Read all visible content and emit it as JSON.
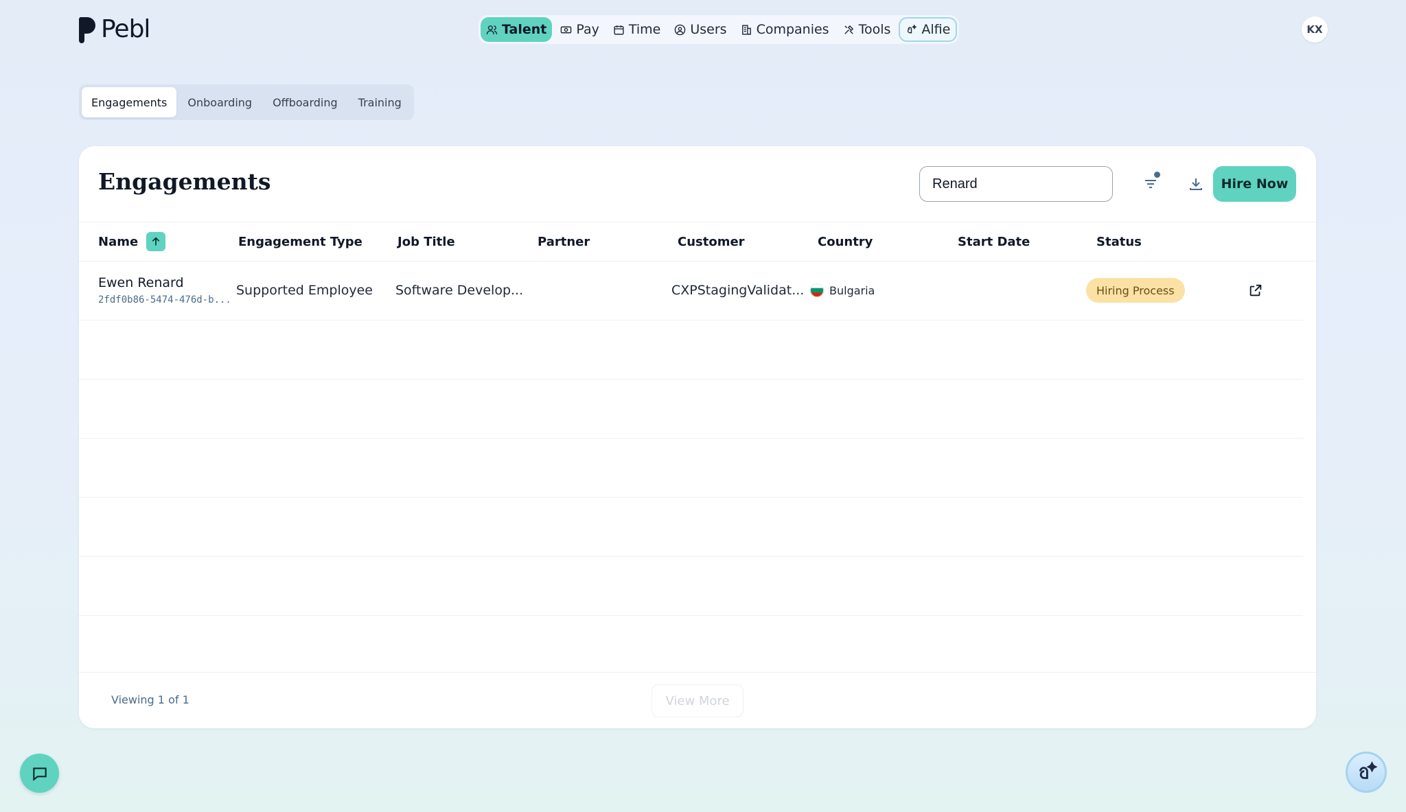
{
  "brand": {
    "name": "Pebl"
  },
  "topnav": {
    "items": [
      {
        "label": "Talent",
        "icon": "users-icon"
      },
      {
        "label": "Pay",
        "icon": "money-icon"
      },
      {
        "label": "Time",
        "icon": "calendar-icon"
      },
      {
        "label": "Users",
        "icon": "user-circle-icon"
      },
      {
        "label": "Companies",
        "icon": "building-icon"
      },
      {
        "label": "Tools",
        "icon": "tools-icon"
      },
      {
        "label": "Alfie",
        "icon": "alfie-icon"
      }
    ],
    "active": "Talent"
  },
  "user": {
    "initials": "KX"
  },
  "subtabs": {
    "items": [
      "Engagements",
      "Onboarding",
      "Offboarding",
      "Training"
    ],
    "active": "Engagements"
  },
  "main": {
    "title": "Engagements",
    "search": {
      "value": "Renard",
      "placeholder": "Search"
    },
    "hire_button": "Hire Now",
    "filter_active": true
  },
  "table": {
    "columns": [
      "Name",
      "Engagement Type",
      "Job Title",
      "Partner",
      "Customer",
      "Country",
      "Start Date",
      "Status"
    ],
    "sort": {
      "column": "Name",
      "direction": "ascending"
    },
    "rows": [
      {
        "name": "Ewen Renard",
        "id": "2fdf0b86-5474-476d-b...",
        "engagement_type": "Supported Employee",
        "job_title": "Software Develop...",
        "partner": "",
        "customer": "CXPStagingValidat...",
        "country": "Bulgaria",
        "start_date": "",
        "status": "Hiring Process"
      }
    ]
  },
  "footer": {
    "viewing": "Viewing 1 of 1",
    "view_more": "View More"
  },
  "colors": {
    "accent": "#5fd3c0",
    "status_hiring": "#fbe1a3",
    "background": "#e4ecf8"
  }
}
